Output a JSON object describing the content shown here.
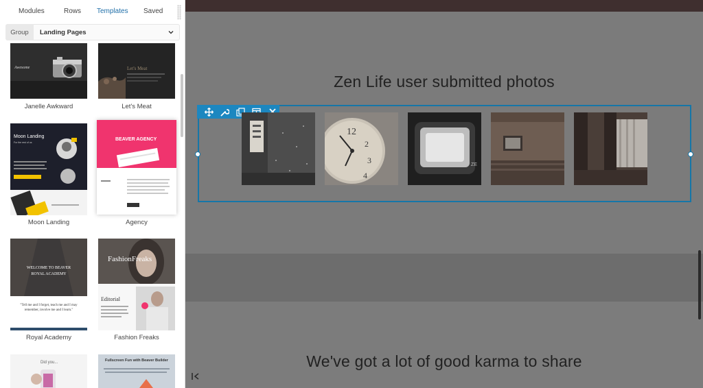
{
  "sidebar": {
    "tabs": [
      {
        "label": "Modules"
      },
      {
        "label": "Rows"
      },
      {
        "label": "Templates"
      },
      {
        "label": "Saved"
      }
    ],
    "active_tab": "Templates",
    "filter": {
      "group_label": "Group",
      "selected_value": "Landing Pages"
    },
    "templates": [
      {
        "label": "Janelle Awkward",
        "thumb_text": "Awesome"
      },
      {
        "label": "Let's Meat",
        "thumb_text": "Let's Meat"
      },
      {
        "label": "Moon Landing",
        "thumb_text": "Moon Landing",
        "thumb_sub": "For the rest of us"
      },
      {
        "label": "Agency",
        "thumb_text": "BEAVER AGENCY"
      },
      {
        "label": "Royal Academy",
        "thumb_text": "WELCOME TO BEAVER ROYAL ACADEMY",
        "thumb_quote": "\"Tell me and I forget, teach me and I may remember, involve me and I learn.\""
      },
      {
        "label": "Fashion Freaks",
        "thumb_text": "FashionFreaks",
        "thumb_sub": "Editorial"
      },
      {
        "label": "",
        "thumb_text": "Did you..."
      },
      {
        "label": "",
        "thumb_text": "Fullscreen Fun with Beaver Builder"
      }
    ]
  },
  "canvas": {
    "heading_top": "Zen Life user submitted photos",
    "heading_bottom": "We've got a lot of good karma to share",
    "toolbar_icons": [
      "move-icon",
      "wrench-icon",
      "duplicate-icon",
      "columns-icon",
      "close-icon"
    ],
    "photos": [
      {
        "name": "photo-sign"
      },
      {
        "name": "photo-clock"
      },
      {
        "name": "photo-window"
      },
      {
        "name": "photo-room"
      },
      {
        "name": "photo-curtain"
      }
    ]
  },
  "colors": {
    "accent": "#1576a8",
    "toolbar": "#1c87c0",
    "active_tab": "#1e6ea8",
    "canvas_overlay": "#7a7a7a",
    "topbar": "#3f2f2f"
  }
}
